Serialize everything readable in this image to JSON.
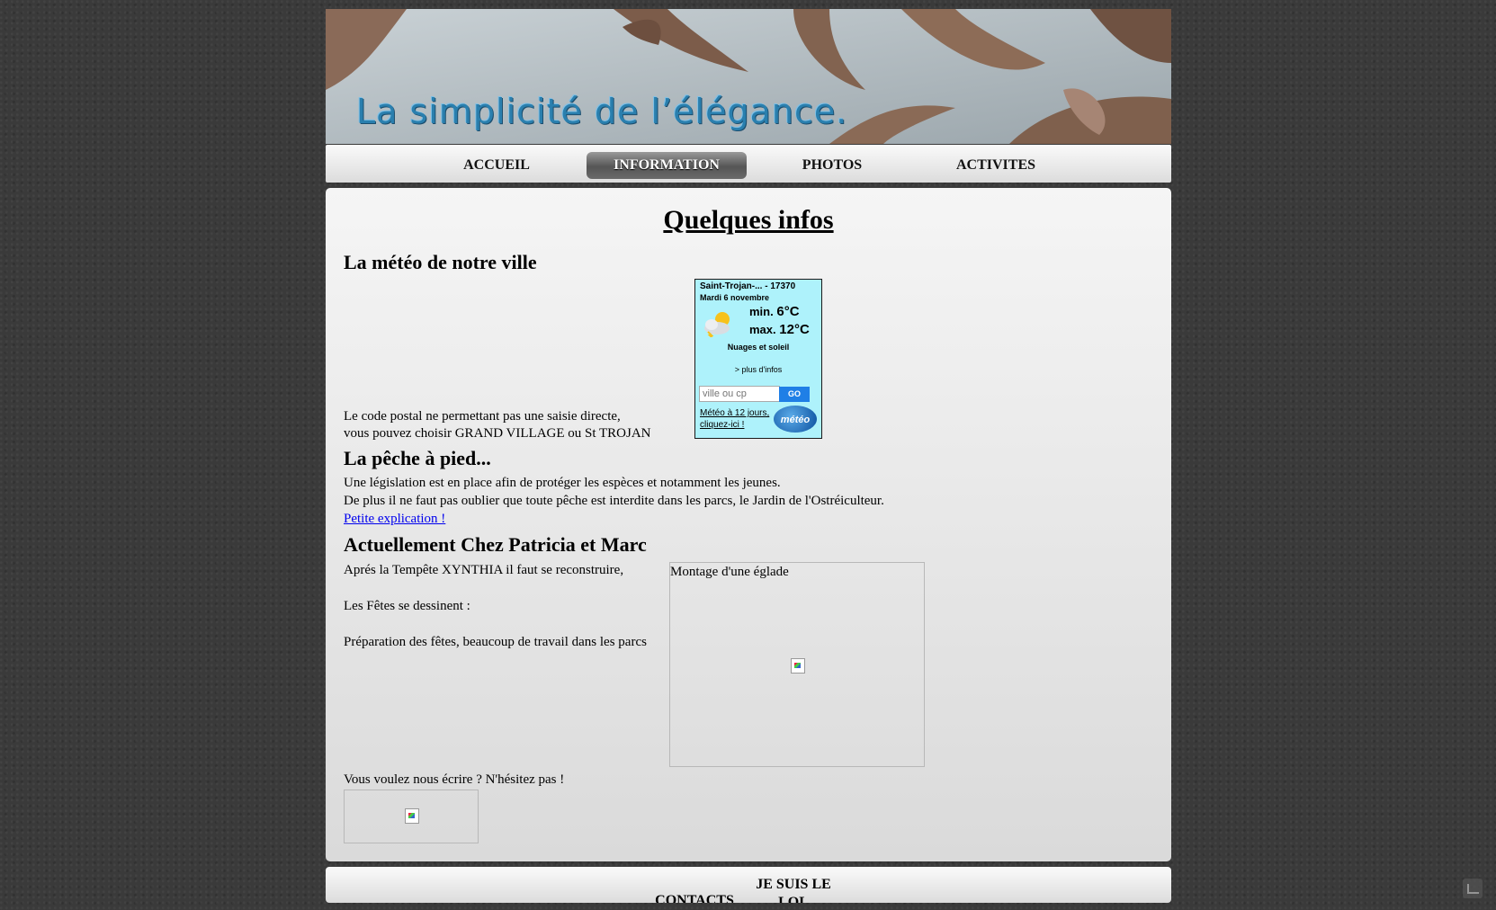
{
  "header": {
    "tagline": "La simplicité de l’élégance."
  },
  "nav": {
    "items": [
      {
        "label": "ACCUEIL"
      },
      {
        "label": "INFORMATION"
      },
      {
        "label": "PHOTOS"
      },
      {
        "label": "ACTIVITES"
      }
    ],
    "active": "INFORMATION"
  },
  "main": {
    "title": "Quelques infos",
    "meteo_heading": "La météo de notre ville",
    "meteo_note_1": "Le code postal ne permettant pas une saisie directe,",
    "meteo_note_2": "vous pouvez choisir GRAND VILLAGE ou St TROJAN",
    "peche_heading": "La pêche à pied...",
    "peche_line_1": "Une législation est en place afin de protéger les espèces et notamment les jeunes.",
    "peche_line_2": "De plus il ne faut pas oublier  que toute pêche est interdite dans les parcs, le Jardin de l'Ostréiculteur.",
    "peche_link": "Petite explication !",
    "actu_heading": "Actuellement Chez Patricia et Marc",
    "actu_line_1": "Aprés la Tempête XYNTHIA il faut se reconstruire,",
    "actu_line_2": "Les Fêtes se dessinent :",
    "actu_line_3": "Préparation des fêtes, beaucoup de travail dans les parcs",
    "eglade_caption": "Montage d'une églade",
    "contact_line": "Vous voulez nous écrire ? N'hésitez pas !"
  },
  "weather": {
    "location": "Saint-Trojan-... - 17370",
    "date": "Mardi 6 novembre",
    "min_label": "min.",
    "min_value": "6°C",
    "max_label": "max.",
    "max_value": "12°C",
    "condition": "Nuages et soleil",
    "more_info": "> plus d'infos",
    "search_placeholder": "ville ou cp",
    "go_label": "GO",
    "forecast_link_1": "Météo à 12 jours,",
    "forecast_link_2": "cliquez-ici !",
    "logo_text": "météo",
    "icon": "cloud-sun-icon"
  },
  "footer": {
    "contacts": "CONTACTS",
    "je_suis_1": "JE SUIS LE",
    "je_suis_2": "LOL"
  },
  "colors": {
    "page_bg": "#3a3a3a",
    "tagline": "#2a7fae",
    "weather_bg": "#aef2fb",
    "go_button": "#1f7fe6",
    "link": "#0000ee"
  }
}
